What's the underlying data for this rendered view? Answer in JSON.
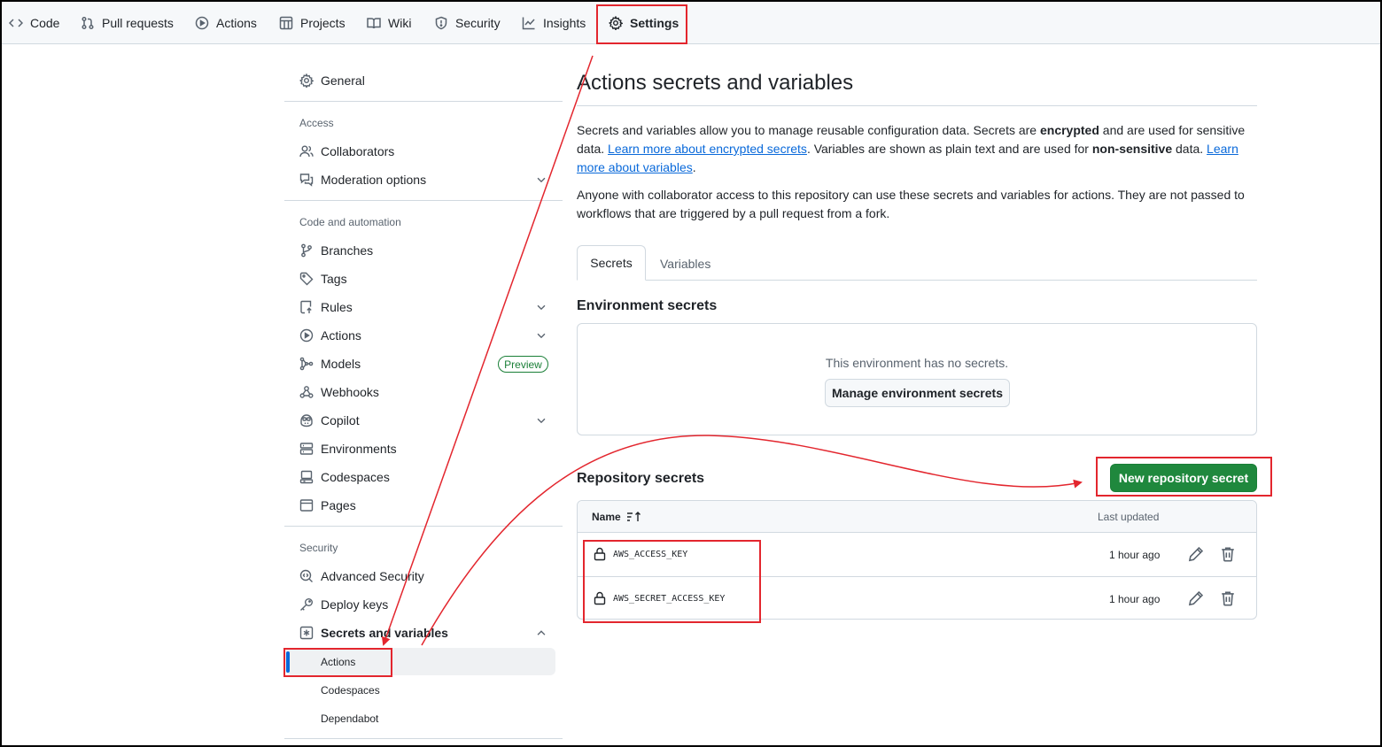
{
  "topnav": {
    "tabs": [
      {
        "label": "Code",
        "icon": "code-icon"
      },
      {
        "label": "Pull requests",
        "icon": "pull-request-icon"
      },
      {
        "label": "Actions",
        "icon": "play-icon"
      },
      {
        "label": "Projects",
        "icon": "table-icon"
      },
      {
        "label": "Wiki",
        "icon": "book-icon"
      },
      {
        "label": "Security",
        "icon": "shield-icon"
      },
      {
        "label": "Insights",
        "icon": "graph-icon"
      },
      {
        "label": "Settings",
        "icon": "gear-icon"
      }
    ],
    "active_tab": "Settings"
  },
  "sidebar": {
    "general": "General",
    "access_heading": "Access",
    "collaborators": "Collaborators",
    "moderation": "Moderation options",
    "code_heading": "Code and automation",
    "branches": "Branches",
    "tags": "Tags",
    "rules": "Rules",
    "actions": "Actions",
    "models": "Models",
    "preview_badge": "Preview",
    "webhooks": "Webhooks",
    "copilot": "Copilot",
    "environments": "Environments",
    "codespaces": "Codespaces",
    "pages": "Pages",
    "security_heading": "Security",
    "advanced_security": "Advanced Security",
    "deploy_keys": "Deploy keys",
    "secrets_vars": "Secrets and variables",
    "sub_actions": "Actions",
    "sub_codespaces": "Codespaces",
    "sub_dependabot": "Dependabot"
  },
  "main": {
    "title": "Actions secrets and variables",
    "p1_a": "Secrets and variables allow you to manage reusable configuration data. Secrets are ",
    "p1_b": "encrypted",
    "p1_c": " and are used for sensitive data. ",
    "p1_link1": "Learn more about encrypted secrets",
    "p1_d": ". Variables are shown as plain text and are used for ",
    "p1_e": "non-sensitive",
    "p1_f": " data. ",
    "p1_link2": "Learn more about variables",
    "p1_g": ".",
    "p2": "Anyone with collaborator access to this repository can use these secrets and variables for actions. They are not passed to workflows that are triggered by a pull request from a fork.",
    "tab_secrets": "Secrets",
    "tab_variables": "Variables",
    "env_heading": "Environment secrets",
    "env_empty": "This environment has no secrets.",
    "env_button": "Manage environment secrets",
    "repo_heading": "Repository secrets",
    "new_secret_button": "New repository secret",
    "table": {
      "col_name": "Name",
      "col_updated": "Last updated",
      "rows": [
        {
          "name": "AWS_ACCESS_KEY",
          "updated": "1 hour ago"
        },
        {
          "name": "AWS_SECRET_ACCESS_KEY",
          "updated": "1 hour ago"
        }
      ]
    }
  },
  "colors": {
    "accent_blue": "#0969da",
    "primary_green": "#1f883d",
    "annotation_red": "#e3262e"
  }
}
